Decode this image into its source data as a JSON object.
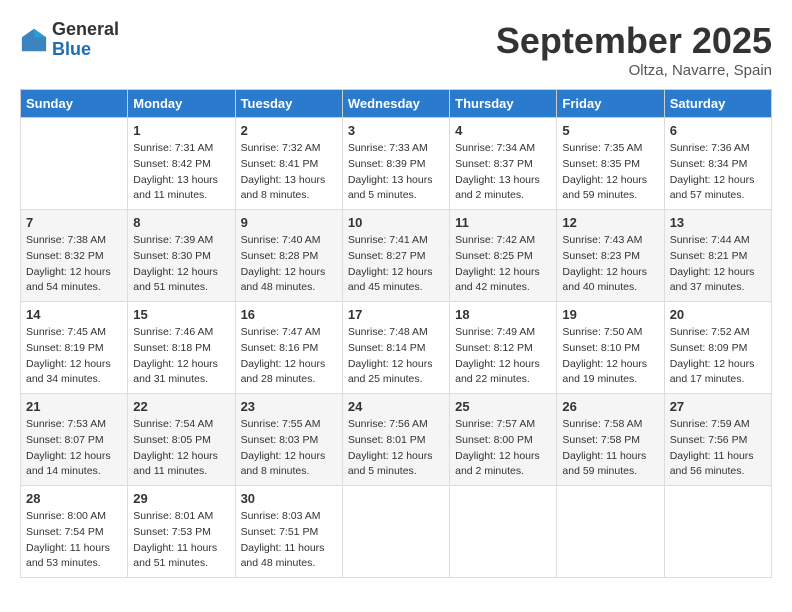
{
  "header": {
    "logo_general": "General",
    "logo_blue": "Blue",
    "month_title": "September 2025",
    "subtitle": "Oltza, Navarre, Spain"
  },
  "days_of_week": [
    "Sunday",
    "Monday",
    "Tuesday",
    "Wednesday",
    "Thursday",
    "Friday",
    "Saturday"
  ],
  "weeks": [
    [
      {
        "day": "",
        "sunrise": "",
        "sunset": "",
        "daylight": ""
      },
      {
        "day": "1",
        "sunrise": "Sunrise: 7:31 AM",
        "sunset": "Sunset: 8:42 PM",
        "daylight": "Daylight: 13 hours and 11 minutes."
      },
      {
        "day": "2",
        "sunrise": "Sunrise: 7:32 AM",
        "sunset": "Sunset: 8:41 PM",
        "daylight": "Daylight: 13 hours and 8 minutes."
      },
      {
        "day": "3",
        "sunrise": "Sunrise: 7:33 AM",
        "sunset": "Sunset: 8:39 PM",
        "daylight": "Daylight: 13 hours and 5 minutes."
      },
      {
        "day": "4",
        "sunrise": "Sunrise: 7:34 AM",
        "sunset": "Sunset: 8:37 PM",
        "daylight": "Daylight: 13 hours and 2 minutes."
      },
      {
        "day": "5",
        "sunrise": "Sunrise: 7:35 AM",
        "sunset": "Sunset: 8:35 PM",
        "daylight": "Daylight: 12 hours and 59 minutes."
      },
      {
        "day": "6",
        "sunrise": "Sunrise: 7:36 AM",
        "sunset": "Sunset: 8:34 PM",
        "daylight": "Daylight: 12 hours and 57 minutes."
      }
    ],
    [
      {
        "day": "7",
        "sunrise": "Sunrise: 7:38 AM",
        "sunset": "Sunset: 8:32 PM",
        "daylight": "Daylight: 12 hours and 54 minutes."
      },
      {
        "day": "8",
        "sunrise": "Sunrise: 7:39 AM",
        "sunset": "Sunset: 8:30 PM",
        "daylight": "Daylight: 12 hours and 51 minutes."
      },
      {
        "day": "9",
        "sunrise": "Sunrise: 7:40 AM",
        "sunset": "Sunset: 8:28 PM",
        "daylight": "Daylight: 12 hours and 48 minutes."
      },
      {
        "day": "10",
        "sunrise": "Sunrise: 7:41 AM",
        "sunset": "Sunset: 8:27 PM",
        "daylight": "Daylight: 12 hours and 45 minutes."
      },
      {
        "day": "11",
        "sunrise": "Sunrise: 7:42 AM",
        "sunset": "Sunset: 8:25 PM",
        "daylight": "Daylight: 12 hours and 42 minutes."
      },
      {
        "day": "12",
        "sunrise": "Sunrise: 7:43 AM",
        "sunset": "Sunset: 8:23 PM",
        "daylight": "Daylight: 12 hours and 40 minutes."
      },
      {
        "day": "13",
        "sunrise": "Sunrise: 7:44 AM",
        "sunset": "Sunset: 8:21 PM",
        "daylight": "Daylight: 12 hours and 37 minutes."
      }
    ],
    [
      {
        "day": "14",
        "sunrise": "Sunrise: 7:45 AM",
        "sunset": "Sunset: 8:19 PM",
        "daylight": "Daylight: 12 hours and 34 minutes."
      },
      {
        "day": "15",
        "sunrise": "Sunrise: 7:46 AM",
        "sunset": "Sunset: 8:18 PM",
        "daylight": "Daylight: 12 hours and 31 minutes."
      },
      {
        "day": "16",
        "sunrise": "Sunrise: 7:47 AM",
        "sunset": "Sunset: 8:16 PM",
        "daylight": "Daylight: 12 hours and 28 minutes."
      },
      {
        "day": "17",
        "sunrise": "Sunrise: 7:48 AM",
        "sunset": "Sunset: 8:14 PM",
        "daylight": "Daylight: 12 hours and 25 minutes."
      },
      {
        "day": "18",
        "sunrise": "Sunrise: 7:49 AM",
        "sunset": "Sunset: 8:12 PM",
        "daylight": "Daylight: 12 hours and 22 minutes."
      },
      {
        "day": "19",
        "sunrise": "Sunrise: 7:50 AM",
        "sunset": "Sunset: 8:10 PM",
        "daylight": "Daylight: 12 hours and 19 minutes."
      },
      {
        "day": "20",
        "sunrise": "Sunrise: 7:52 AM",
        "sunset": "Sunset: 8:09 PM",
        "daylight": "Daylight: 12 hours and 17 minutes."
      }
    ],
    [
      {
        "day": "21",
        "sunrise": "Sunrise: 7:53 AM",
        "sunset": "Sunset: 8:07 PM",
        "daylight": "Daylight: 12 hours and 14 minutes."
      },
      {
        "day": "22",
        "sunrise": "Sunrise: 7:54 AM",
        "sunset": "Sunset: 8:05 PM",
        "daylight": "Daylight: 12 hours and 11 minutes."
      },
      {
        "day": "23",
        "sunrise": "Sunrise: 7:55 AM",
        "sunset": "Sunset: 8:03 PM",
        "daylight": "Daylight: 12 hours and 8 minutes."
      },
      {
        "day": "24",
        "sunrise": "Sunrise: 7:56 AM",
        "sunset": "Sunset: 8:01 PM",
        "daylight": "Daylight: 12 hours and 5 minutes."
      },
      {
        "day": "25",
        "sunrise": "Sunrise: 7:57 AM",
        "sunset": "Sunset: 8:00 PM",
        "daylight": "Daylight: 12 hours and 2 minutes."
      },
      {
        "day": "26",
        "sunrise": "Sunrise: 7:58 AM",
        "sunset": "Sunset: 7:58 PM",
        "daylight": "Daylight: 11 hours and 59 minutes."
      },
      {
        "day": "27",
        "sunrise": "Sunrise: 7:59 AM",
        "sunset": "Sunset: 7:56 PM",
        "daylight": "Daylight: 11 hours and 56 minutes."
      }
    ],
    [
      {
        "day": "28",
        "sunrise": "Sunrise: 8:00 AM",
        "sunset": "Sunset: 7:54 PM",
        "daylight": "Daylight: 11 hours and 53 minutes."
      },
      {
        "day": "29",
        "sunrise": "Sunrise: 8:01 AM",
        "sunset": "Sunset: 7:53 PM",
        "daylight": "Daylight: 11 hours and 51 minutes."
      },
      {
        "day": "30",
        "sunrise": "Sunrise: 8:03 AM",
        "sunset": "Sunset: 7:51 PM",
        "daylight": "Daylight: 11 hours and 48 minutes."
      },
      {
        "day": "",
        "sunrise": "",
        "sunset": "",
        "daylight": ""
      },
      {
        "day": "",
        "sunrise": "",
        "sunset": "",
        "daylight": ""
      },
      {
        "day": "",
        "sunrise": "",
        "sunset": "",
        "daylight": ""
      },
      {
        "day": "",
        "sunrise": "",
        "sunset": "",
        "daylight": ""
      }
    ]
  ]
}
